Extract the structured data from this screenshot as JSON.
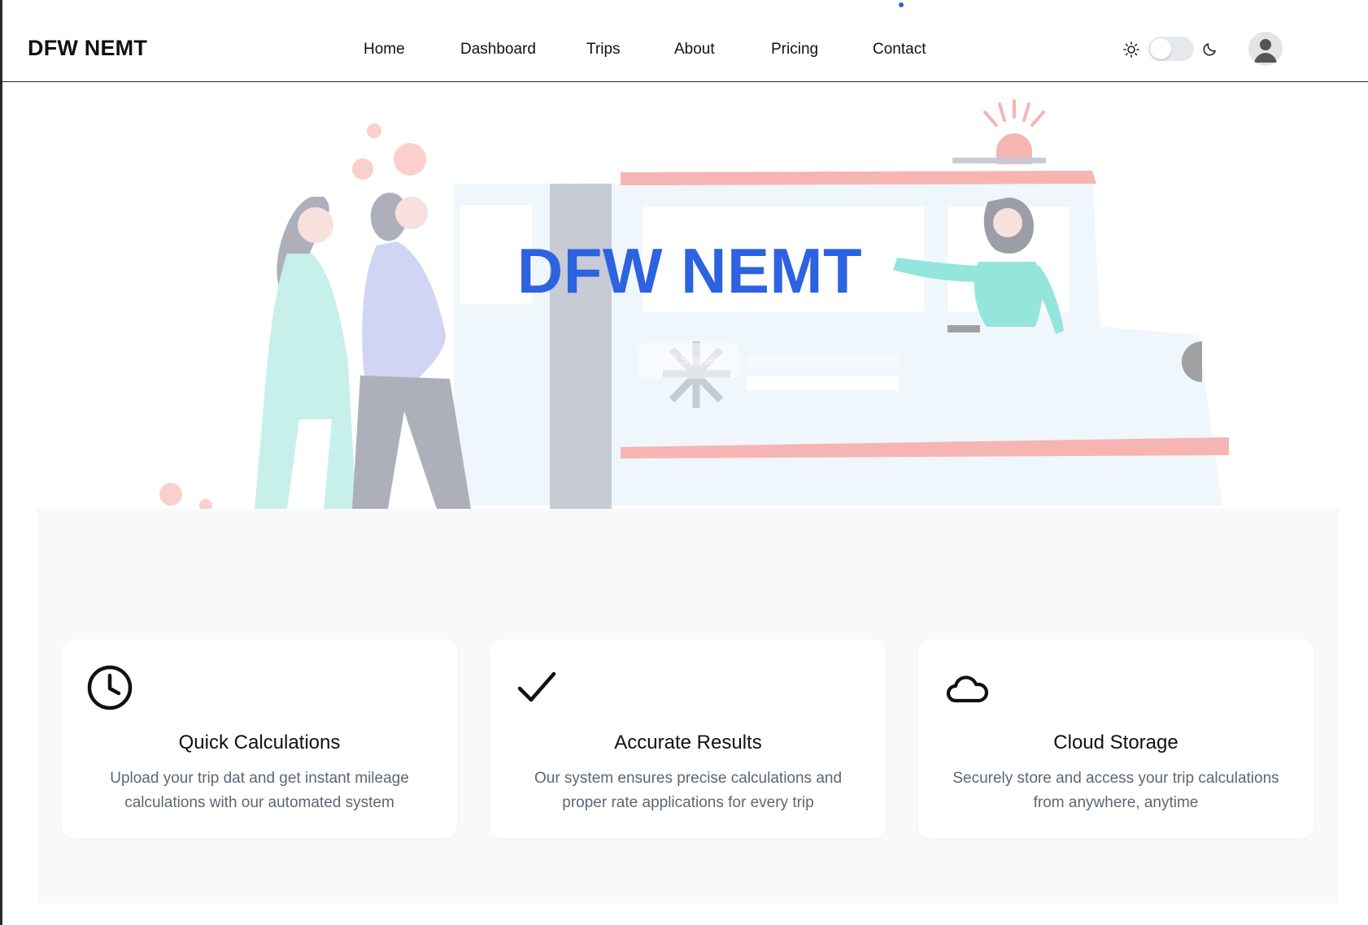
{
  "brand": "DFW NEMT",
  "nav": {
    "items": [
      {
        "label": "Home"
      },
      {
        "label": "Dashboard"
      },
      {
        "label": "Trips"
      },
      {
        "label": "About"
      },
      {
        "label": "Pricing"
      },
      {
        "label": "Contact"
      }
    ]
  },
  "theme_toggle": {
    "state": "light",
    "sun_icon": "sun-icon",
    "moon_icon": "moon-icon"
  },
  "hero": {
    "title": "DFW NEMT",
    "cta_label": "Get Started"
  },
  "features": [
    {
      "icon": "clock-icon",
      "title": "Quick Calculations",
      "description": "Upload your trip dat and get instant mileage calculations with our automated system"
    },
    {
      "icon": "check-icon",
      "title": "Accurate Results",
      "description": "Our system ensures precise calculations and proper rate applications for every trip"
    },
    {
      "icon": "cloud-icon",
      "title": "Cloud Storage",
      "description": "Securely store and access your trip calculations from anywhere, anytime"
    }
  ],
  "colors": {
    "accent": "#2d62e0",
    "feature_bg": "#f8f9fa",
    "muted_text": "#5d6677"
  }
}
